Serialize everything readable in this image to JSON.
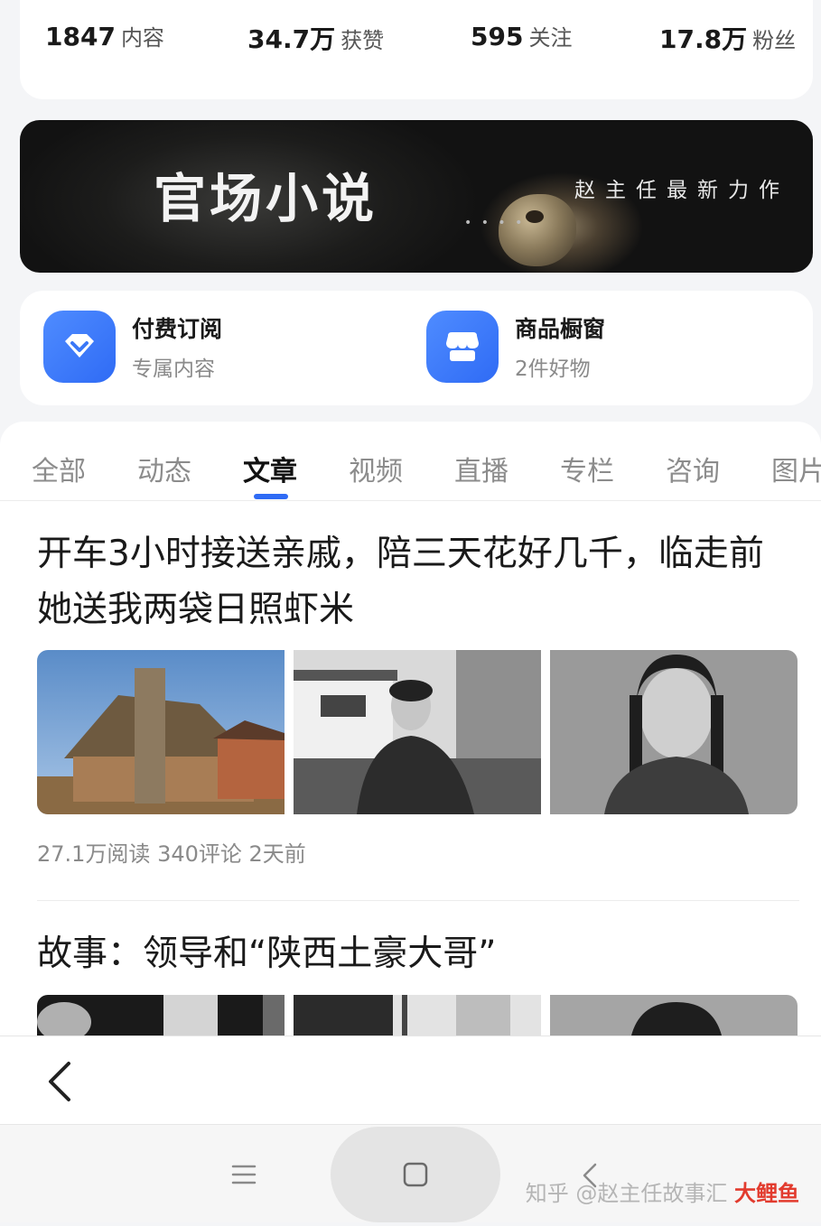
{
  "stats": [
    {
      "num": "1847",
      "label": "内容"
    },
    {
      "num": "34.7万",
      "label": "获赞"
    },
    {
      "num": "595",
      "label": "关注"
    },
    {
      "num": "17.8万",
      "label": "粉丝"
    }
  ],
  "banner": {
    "title": "官场小说",
    "subtitle": "赵主任最新力作"
  },
  "entries": [
    {
      "title": "付费订阅",
      "subtitle": "专属内容",
      "icon": "diamond-icon"
    },
    {
      "title": "商品橱窗",
      "subtitle": "2件好物",
      "icon": "shop-icon"
    }
  ],
  "tabs": [
    "全部",
    "动态",
    "文章",
    "视频",
    "直播",
    "专栏",
    "咨询",
    "图片"
  ],
  "active_tab": "文章",
  "articles": [
    {
      "title": "开车3小时接送亲戚，陪三天花好几千，临走前她送我两袋日照虾米",
      "meta": "27.1万阅读  340评论  2天前"
    },
    {
      "title": "故事：领导和“陕西土豪大哥”"
    }
  ],
  "watermark": {
    "text": "知乎 @赵主任故事汇",
    "logo": "大鲤鱼"
  },
  "colors": {
    "accent": "#2f6bf5",
    "background": "#f4f5f7"
  }
}
